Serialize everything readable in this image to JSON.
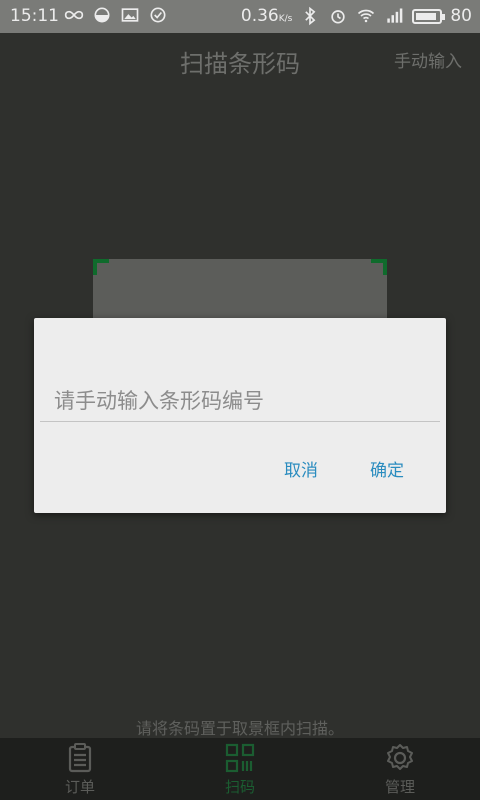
{
  "status_bar": {
    "time": "15:11",
    "net_speed": "0.36",
    "net_speed_unit": "K/s",
    "battery": "80"
  },
  "header": {
    "title": "扫描条形码",
    "manual_input": "手动输入"
  },
  "scanner": {
    "hint": "请将条码置于取景框内扫描。",
    "corner_color": "#0f6b2c"
  },
  "dialog": {
    "input_placeholder": "请手动输入条形码编号",
    "input_value": "",
    "cancel_label": "取消",
    "confirm_label": "确定",
    "button_color": "#2a8cbf"
  },
  "bottom_nav": {
    "items": [
      {
        "label": "订单",
        "icon": "clipboard-icon"
      },
      {
        "label": "扫码",
        "icon": "qr-code-icon",
        "active": true
      },
      {
        "label": "管理",
        "icon": "gear-icon"
      }
    ]
  }
}
